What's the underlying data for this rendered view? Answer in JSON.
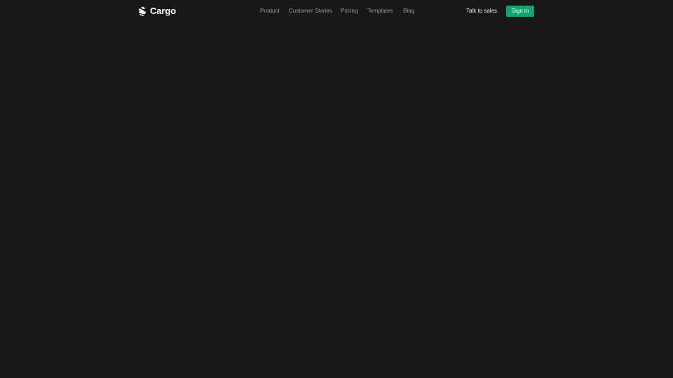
{
  "brand": {
    "name": "Cargo",
    "logo_icon": "cargo-logo-icon"
  },
  "nav": {
    "items": [
      {
        "label": "Product"
      },
      {
        "label": "Customer Stories"
      },
      {
        "label": "Pricing"
      },
      {
        "label": "Templates"
      },
      {
        "label": "Blog"
      }
    ]
  },
  "actions": {
    "talk_to_sales": "Talk to sales",
    "sign_in": "Sign in"
  },
  "colors": {
    "background": "#181818",
    "accent": "#13a36e",
    "nav_text": "#9a9a9a",
    "text_primary": "#ffffff"
  }
}
